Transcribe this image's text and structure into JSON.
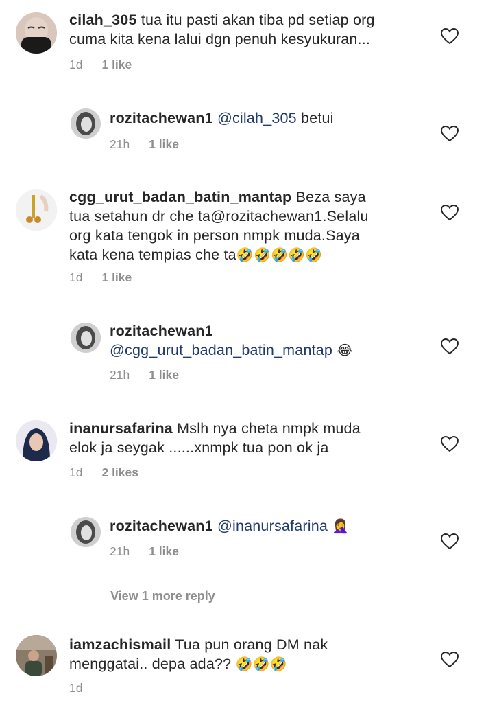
{
  "comments": [
    {
      "username": "cilah_305",
      "text_line1": "tua itu pasti akan tiba pd setiap org",
      "text_line2": "cuma kita kena lalui dgn penuh kesyukuran...",
      "time": "1d",
      "likes": "1 like"
    },
    {
      "username": "rozitachewan1",
      "mention": "@cilah_305",
      "text": "betui",
      "time": "21h",
      "likes": "1 like"
    },
    {
      "username": "cgg_urut_badan_batin_mantap",
      "text_line1": "Beza saya",
      "text_line2": "tua setahun dr che ta@rozitachewan1.Selalu",
      "text_line3": "org kata tengok in person nmpk muda.Saya",
      "text_line4": "kata kena tempias che ta",
      "emojis": "🤣🤣🤣🤣🤣",
      "time": "1d",
      "likes": "1 like"
    },
    {
      "username": "rozitachewan1",
      "mention": "@cgg_urut_badan_batin_mantap",
      "emojis": "😂",
      "time": "21h",
      "likes": "1 like"
    },
    {
      "username": "inanursafarina",
      "text_line1": "Mslh nya cheta nmpk muda",
      "text_line2": "elok ja seygak ......xnmpk tua pon ok ja",
      "time": "1d",
      "likes": "2 likes"
    },
    {
      "username": "rozitachewan1",
      "mention": "@inanursafarina",
      "emojis": "🤦‍♀️",
      "time": "21h",
      "likes": "1 like"
    },
    {
      "username": "iamzachismail",
      "text_line1": "Tua pun orang DM nak",
      "text_line2": "menggatai.. depa ada??",
      "emojis": "🤣🤣🤣",
      "time": "1d"
    }
  ],
  "view_more_replies": "View 1 more reply",
  "icons": {
    "like": "heart-outline-icon"
  },
  "colors": {
    "text": "#262626",
    "meta": "#8e8e8e",
    "mention": "#1f3a6e"
  }
}
